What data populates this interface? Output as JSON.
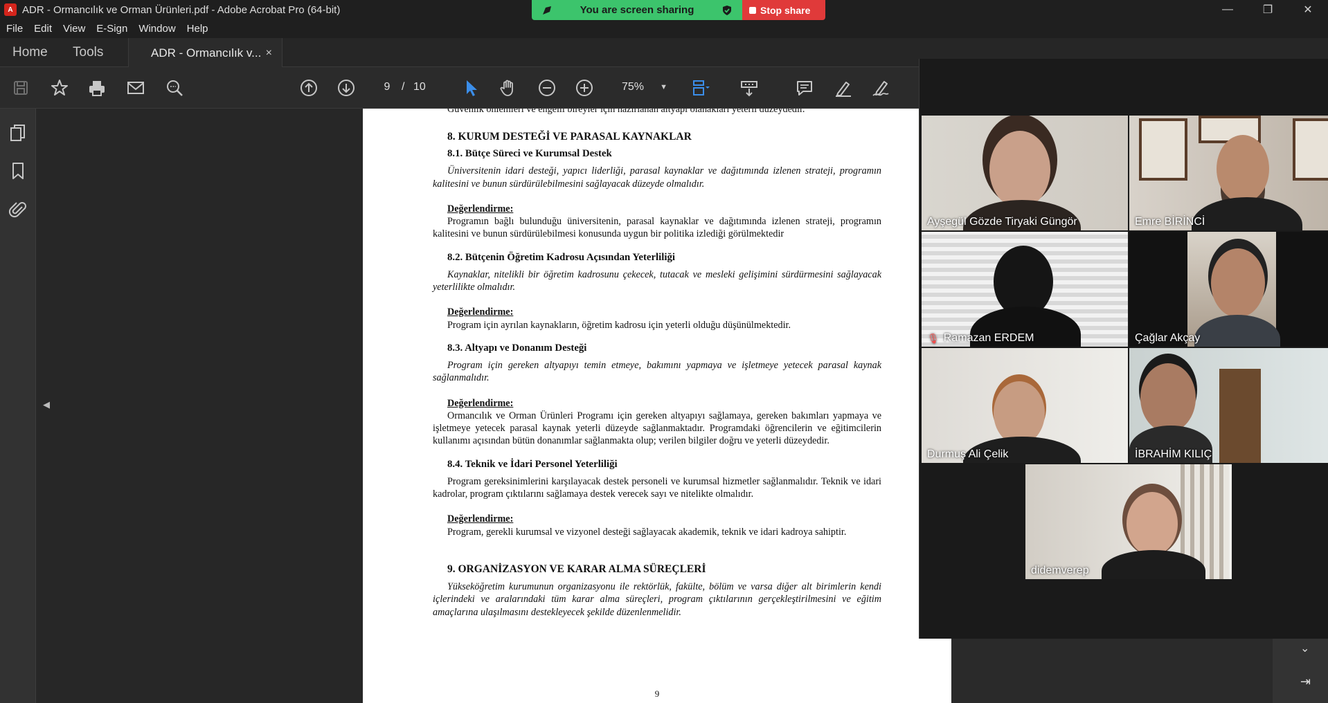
{
  "window": {
    "title": "ADR - Ormancılık ve Orman Ürünleri.pdf - Adobe Acrobat Pro (64-bit)",
    "controls": [
      "—",
      "❐",
      "✕"
    ]
  },
  "screen_share": {
    "status": "You are screen sharing",
    "stop_label": "Stop share"
  },
  "menu": [
    "File",
    "Edit",
    "View",
    "E-Sign",
    "Window",
    "Help"
  ],
  "tabs": {
    "home": "Home",
    "tools": "Tools",
    "document": "ADR - Ormancılık v...",
    "close": "×"
  },
  "toolbar": {
    "current_page": "9",
    "separator": "/",
    "total_pages": "10",
    "zoom": "75%"
  },
  "document": {
    "top_line": "Güvenlik önlemleri ve engelli bireyler için hazırlanan altyapı olanakları yeterli düzeydedir.",
    "s8_title": "8. KURUM DESTEĞİ VE PARASAL KAYNAKLAR",
    "s81_title": "8.1. Bütçe Süreci ve Kurumsal Destek",
    "s81_req": "Üniversitenin idari desteği, yapıcı liderliği, parasal kaynaklar ve dağıtımında izlenen strateji, programın kalitesini ve bunun sürdürülebilmesini sağlayacak düzeyde olmalıdır.",
    "eval_label": "Değerlendirme:",
    "s81_eval": "Programın bağlı bulunduğu üniversitenin, parasal kaynaklar ve dağıtımında izlenen strateji, programın kalitesini ve bunun sürdürülebilmesi konusunda uygun bir politika izlediği görülmektedir",
    "s82_title": "8.2. Bütçenin Öğretim Kadrosu Açısından Yeterliliği",
    "s82_req": "Kaynaklar, nitelikli bir öğretim kadrosunu çekecek, tutacak ve mesleki gelişimini sürdürmesini sağlayacak yeterlilikte olmalıdır.",
    "s82_eval": "Program için ayrılan kaynakların, öğretim kadrosu için yeterli olduğu düşünülmektedir.",
    "s83_title": "8.3. Altyapı ve Donanım Desteği",
    "s83_req": "Program için gereken altyapıyı temin etmeye, bakımını yapmaya ve işletmeye yetecek parasal kaynak sağlanmalıdır.",
    "s83_eval": "Ormancılık ve Orman Ürünleri Programı için gereken altyapıyı sağlamaya, gereken bakımları yapmaya ve işletmeye yetecek parasal kaynak yeterli düzeyde sağlanmaktadır. Programdaki öğrencilerin ve eğitimcilerin kullanımı açısından bütün donanımlar sağlanmakta olup; verilen bilgiler doğru ve yeterli düzeydedir.",
    "s84_title": "8.4. Teknik ve İdari Personel Yeterliliği",
    "s84_req": "Program gereksinimlerini karşılayacak destek personeli ve kurumsal hizmetler sağlanmalıdır. Teknik ve idari kadrolar, program çıktılarını sağlamaya destek verecek sayı ve nitelikte olmalıdır.",
    "s84_eval": "Program, gerekli kurumsal ve vizyonel desteği sağlayacak akademik, teknik ve idari kadroya sahiptir.",
    "s9_title": "9. ORGANİZASYON VE KARAR ALMA SÜREÇLERİ",
    "s9_req": "Yükseköğretim kurumunun organizasyonu ile rektörlük, fakülte, bölüm ve varsa diğer alt birimlerin kendi içlerindeki ve aralarındaki tüm karar alma süreçleri, program çıktılarının gerçekleştirilmesini ve eğitim amaçlarına ulaşılmasını destekleyecek şekilde düzenlenmelidir.",
    "page_number": "9"
  },
  "participants": [
    {
      "name": "Ayşegül Gözde Tiryaki Güngör",
      "muted": false
    },
    {
      "name": "Emre BİRİNCİ",
      "muted": false
    },
    {
      "name": "Ramazan ERDEM",
      "muted": true
    },
    {
      "name": "Çağlar Akçay",
      "muted": false,
      "active": true
    },
    {
      "name": "Durmuş Ali Çelik",
      "muted": false
    },
    {
      "name": "İBRAHİM KILIÇ",
      "muted": false
    },
    {
      "name": "didemverep",
      "muted": false
    }
  ],
  "icons": {
    "save": "save-icon",
    "star": "star-icon",
    "print": "print-icon",
    "mail": "mail-icon",
    "search": "search-zoom-icon",
    "prev_page": "arrow-up-circle-icon",
    "next_page": "arrow-down-circle-icon",
    "select": "cursor-icon",
    "hand": "hand-icon",
    "zoom_out": "zoom-out-icon",
    "zoom_in": "zoom-in-icon",
    "fit": "fit-page-icon",
    "scroll": "scroll-mode-icon",
    "comment": "comment-icon",
    "highlight": "highlight-icon",
    "sign": "sign-icon",
    "mic_off": "mic-off-icon"
  },
  "colors": {
    "share_green": "#3cc46c",
    "share_red": "#e03a3a",
    "active_speaker": "#2fd07a",
    "select_tool": "#3b8eea"
  }
}
